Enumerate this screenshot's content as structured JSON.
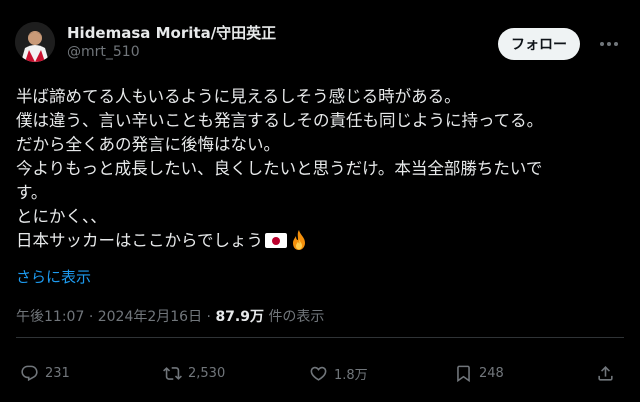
{
  "author": {
    "name": "Hidemasa Morita/守田英正",
    "handle": "@mrt_510"
  },
  "follow_label": "フォロー",
  "tweet": {
    "lines": [
      "半ば諦めてる人もいるように見えるしそう感じる時がある。",
      "僕は違う、言い辛いことも発言するしその責任も同じように持ってる。",
      "だから全くあの発言に後悔はない。",
      "今よりもっと成長したい、良くしたいと思うだけ。本当全部勝ちたいで",
      "す。",
      "とにかく、、",
      "日本サッカーはここからでしょう"
    ],
    "emoji": [
      "flag-japan",
      "fire"
    ],
    "show_more": "さらに表示"
  },
  "meta": {
    "time": "午後11:07",
    "sep1": "·",
    "date": "2024年2月16日",
    "sep2": "·",
    "views": "87.9万",
    "views_label": "件の表示"
  },
  "actions": {
    "replies": "231",
    "reposts": "2,530",
    "likes": "1.8万",
    "bookmarks": "248"
  },
  "icons": [
    "more-icon",
    "reply-icon",
    "repost-icon",
    "like-icon",
    "bookmark-icon",
    "share-icon"
  ],
  "colors": {
    "background": "#000000",
    "text": "#e7e9ea",
    "secondary": "#71767b",
    "link": "#1d9bf0",
    "follow_bg": "#eff3f4",
    "divider": "#2f3336"
  }
}
